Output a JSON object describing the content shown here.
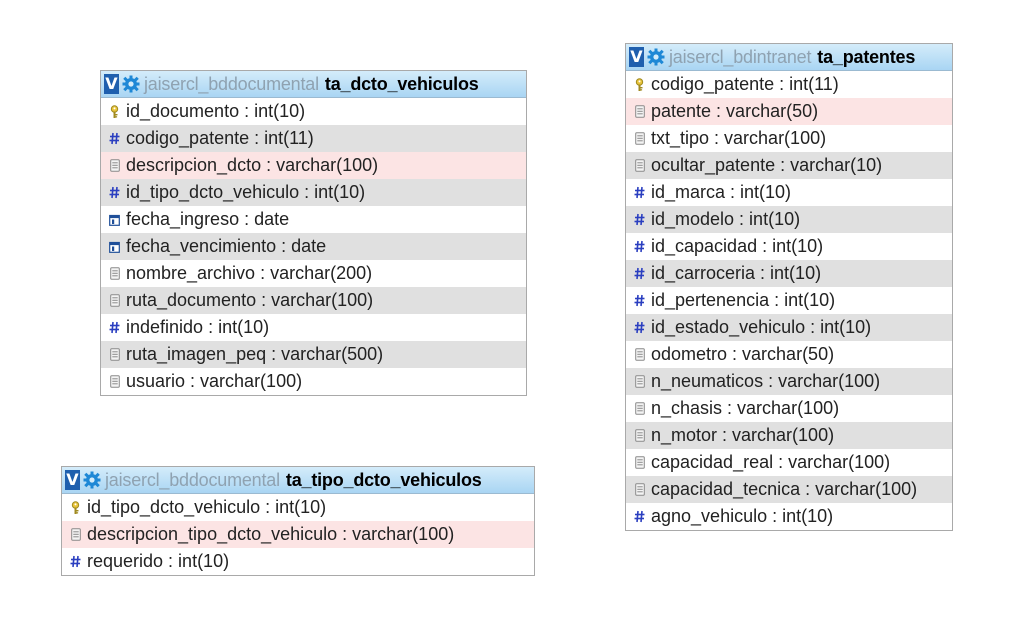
{
  "tables": [
    {
      "db": "jaisercl_bddocumental",
      "name": "ta_dcto_vehiculos",
      "fields": [
        {
          "text": "id_documento : int(10)",
          "icon": "key-icon",
          "bg": "plain"
        },
        {
          "text": "codigo_patente : int(11)",
          "icon": "hash-icon",
          "bg": "alt"
        },
        {
          "text": "descripcion_dcto : varchar(100)",
          "icon": "text-icon",
          "bg": "hl"
        },
        {
          "text": "id_tipo_dcto_vehiculo : int(10)",
          "icon": "hash-icon",
          "bg": "alt"
        },
        {
          "text": "fecha_ingreso : date",
          "icon": "calendar-icon",
          "bg": "plain"
        },
        {
          "text": "fecha_vencimiento : date",
          "icon": "calendar-icon",
          "bg": "alt"
        },
        {
          "text": "nombre_archivo : varchar(200)",
          "icon": "text-icon",
          "bg": "plain"
        },
        {
          "text": "ruta_documento : varchar(100)",
          "icon": "text-icon",
          "bg": "alt"
        },
        {
          "text": "indefinido : int(10)",
          "icon": "hash-icon",
          "bg": "plain"
        },
        {
          "text": "ruta_imagen_peq : varchar(500)",
          "icon": "text-icon",
          "bg": "alt"
        },
        {
          "text": "usuario : varchar(100)",
          "icon": "text-icon",
          "bg": "plain"
        }
      ]
    },
    {
      "db": "jaisercl_bddocumental",
      "name": "ta_tipo_dcto_vehiculos",
      "fields": [
        {
          "text": "id_tipo_dcto_vehiculo : int(10)",
          "icon": "key-icon",
          "bg": "plain"
        },
        {
          "text": "descripcion_tipo_dcto_vehiculo : varchar(100)",
          "icon": "text-icon",
          "bg": "hl"
        },
        {
          "text": "requerido : int(10)",
          "icon": "hash-icon",
          "bg": "plain"
        }
      ]
    },
    {
      "db": "jaisercl_bdintranet",
      "name": "ta_patentes",
      "fields": [
        {
          "text": "codigo_patente : int(11)",
          "icon": "key-icon",
          "bg": "plain"
        },
        {
          "text": "patente : varchar(50)",
          "icon": "text-icon",
          "bg": "hl"
        },
        {
          "text": "txt_tipo : varchar(100)",
          "icon": "text-icon",
          "bg": "plain"
        },
        {
          "text": "ocultar_patente : varchar(10)",
          "icon": "text-icon",
          "bg": "alt"
        },
        {
          "text": "id_marca : int(10)",
          "icon": "hash-icon",
          "bg": "plain"
        },
        {
          "text": "id_modelo : int(10)",
          "icon": "hash-icon",
          "bg": "alt"
        },
        {
          "text": "id_capacidad : int(10)",
          "icon": "hash-icon",
          "bg": "plain"
        },
        {
          "text": "id_carroceria : int(10)",
          "icon": "hash-icon",
          "bg": "alt"
        },
        {
          "text": "id_pertenencia : int(10)",
          "icon": "hash-icon",
          "bg": "plain"
        },
        {
          "text": "id_estado_vehiculo : int(10)",
          "icon": "hash-icon",
          "bg": "alt"
        },
        {
          "text": "odometro : varchar(50)",
          "icon": "text-icon",
          "bg": "plain"
        },
        {
          "text": "n_neumaticos : varchar(100)",
          "icon": "text-icon",
          "bg": "alt"
        },
        {
          "text": "n_chasis : varchar(100)",
          "icon": "text-icon",
          "bg": "plain"
        },
        {
          "text": "n_motor : varchar(100)",
          "icon": "text-icon",
          "bg": "alt"
        },
        {
          "text": "capacidad_real : varchar(100)",
          "icon": "text-icon",
          "bg": "plain"
        },
        {
          "text": "capacidad_tecnica : varchar(100)",
          "icon": "text-icon",
          "bg": "alt"
        },
        {
          "text": "agno_vehiculo : int(10)",
          "icon": "hash-icon",
          "bg": "plain"
        }
      ]
    }
  ],
  "toggle_label": "V",
  "colors": {
    "hash": "#2b3fc0",
    "text": "#8a8a8a",
    "key": "#a08a20",
    "calendar": "#1f4f99"
  }
}
